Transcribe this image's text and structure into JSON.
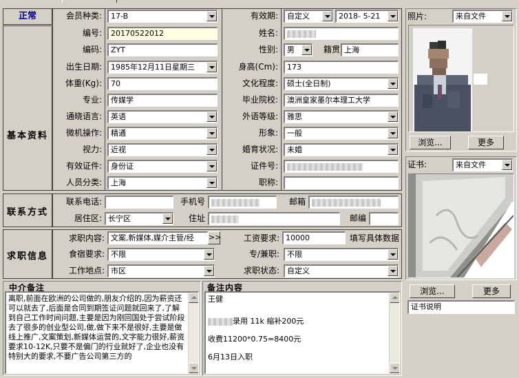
{
  "status": "正常",
  "sections": {
    "basic": "基本资料",
    "contact": "联系方式",
    "job": "求职信息",
    "agency_notes": "中介备注",
    "remarks": "备注内容"
  },
  "fields": {
    "member_type": {
      "label": "会员种类:",
      "value": "17-B"
    },
    "validity": {
      "label": "有效期:",
      "mode": "自定义",
      "date": "2018- 5-21"
    },
    "number": {
      "label": "编号:",
      "value": "20170522012"
    },
    "name": {
      "label": "姓名:"
    },
    "code": {
      "label": "编码:",
      "value": "ZYT"
    },
    "gender": {
      "label": "性别:",
      "value": "男"
    },
    "native": {
      "label": "籍贯",
      "value": "上海"
    },
    "birth": {
      "label": "出生日期:",
      "value": "1985年12月11日星期三"
    },
    "height": {
      "label": "身高(Cm):",
      "value": "173"
    },
    "weight": {
      "label": "体重(Kg):",
      "value": "70"
    },
    "education": {
      "label": "文化程度:",
      "value": "硕士(全日制)"
    },
    "major": {
      "label": "专业:",
      "value": "传媒学"
    },
    "school": {
      "label": "毕业院校:",
      "value": "澳洲皇家墨尔本理工大学"
    },
    "language": {
      "label": "通晓语言:",
      "value": "英语"
    },
    "foreign_level": {
      "label": "外语等级:",
      "value": "雅思"
    },
    "computer": {
      "label": "微机操作:",
      "value": "精通"
    },
    "appearance": {
      "label": "形象:",
      "value": "一般"
    },
    "vision": {
      "label": "视力:",
      "value": "近视"
    },
    "marital": {
      "label": "婚育状况:",
      "value": "未婚"
    },
    "id_type": {
      "label": "有效证件:",
      "value": "身份证"
    },
    "id_number": {
      "label": "证件号:"
    },
    "category": {
      "label": "人员分类:",
      "value": "上海"
    },
    "title": {
      "label": "职称:",
      "value": ""
    },
    "phone": {
      "label": "联系电话:",
      "value": ""
    },
    "mobile": {
      "label": "手机号"
    },
    "email": {
      "label": "邮箱"
    },
    "district": {
      "label": "居住区:",
      "value": "长宁区"
    },
    "address": {
      "label": "住址"
    },
    "postcode": {
      "label": "邮编",
      "value": ""
    },
    "job_content": {
      "label": "求职内容:",
      "value": "文案,新媒体,媒介主管/经"
    },
    "more_btn": ">>",
    "salary": {
      "label": "工资要求:",
      "value": "10000",
      "hint": "填写具体数据"
    },
    "board": {
      "label": "食宿要求:",
      "value": "不限"
    },
    "fulltime": {
      "label": "专/兼职:",
      "value": "不限"
    },
    "location": {
      "label": "工作地点:",
      "value": "市区"
    },
    "job_status": {
      "label": "求职状态:",
      "value": "自定义"
    }
  },
  "photo": {
    "label": "照片:",
    "source": "来自文件",
    "browse": "浏览...",
    "more": "更多"
  },
  "cert": {
    "label": "证书:",
    "source": "来自文件",
    "browse": "浏览...",
    "more": "更多",
    "desc": "证书说明"
  },
  "agency_notes_text": "离职,前面在欧洲的公司做的,朋友介绍的,因为薪资还可以就去了,后面是合同到期签证问题就回来了,了解到自己工作时间问题,主要是因为刚回国处于尝试阶段去了很多的创业型公司,做,做下来不是很好,主要是做线上推广,文案策划,新媒体运营的,文字能力很好,薪资要求10-12K,只要不是偏门的行业就好了,企业也没有特别大的要求,不要广告公司第三方的",
  "remarks_text": {
    "line1": "王健",
    "line2": "录用 11k 缩补200元",
    "line3": "收费11200*0.75=8400元",
    "line4": "6月13日入职"
  }
}
